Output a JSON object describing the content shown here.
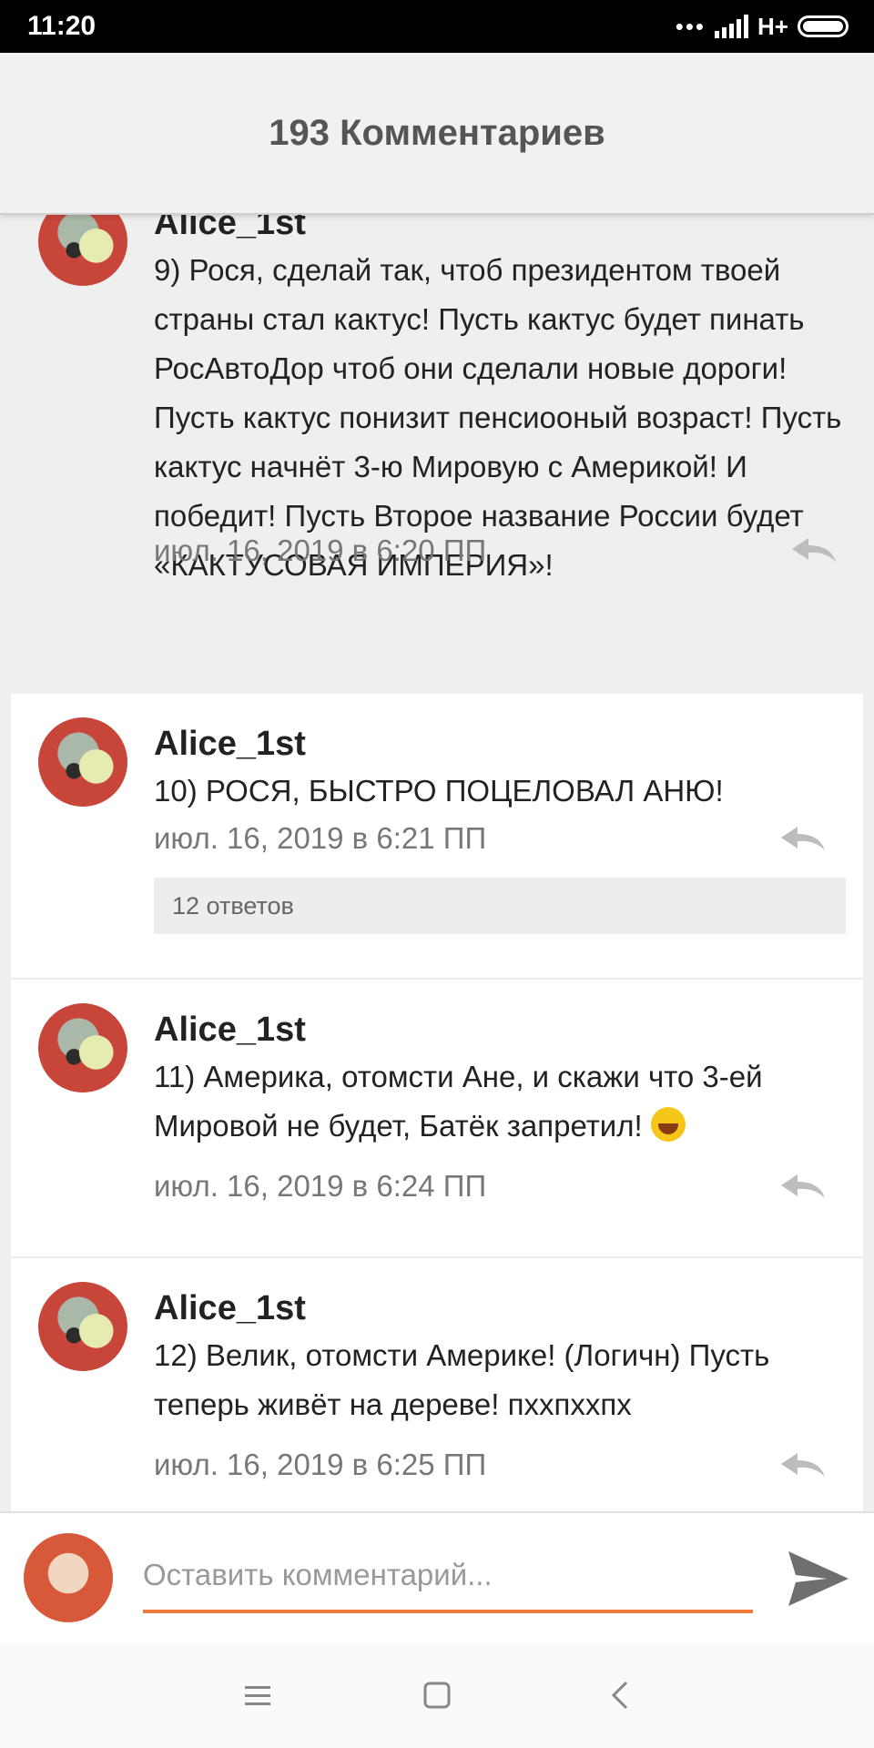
{
  "status_bar": {
    "time": "11:20",
    "network": "H+"
  },
  "header": {
    "title": "193 Комментариев"
  },
  "comments": [
    {
      "author": "Alice_1st",
      "text": "9) Рося, сделай так, чтоб президентом твоей страны стал кактус! Пусть кактус будет пинать РосАвтоДор чтоб они сделали новые дороги! Пусть кактус понизит пенсиооный возраст! Пусть кактус начнёт 3-ю Мировую с Америкой! И победит! Пусть Второе название России будет «КАКТУСОВАЯ ИМПЕРИЯ»!",
      "date": "июл. 16, 2019 в 6:20 ПП"
    },
    {
      "author": "Alice_1st",
      "text": "10) РОСЯ, БЫСТРО ПОЦЕЛОВАЛ АНЮ!",
      "date": "июл. 16, 2019 в 6:21 ПП",
      "replies_label": "12 ответов"
    },
    {
      "author": "Alice_1st",
      "text": "11) Америка, отомсти Ане, и скажи что 3-ей Мировой не будет, Батёк запретил!",
      "date": "июл. 16, 2019 в 6:24 ПП"
    },
    {
      "author": "Alice_1st",
      "text": "12) Велик, отомсти Америке! (Логичн) Пусть теперь живёт на дереве! пххпххпх",
      "date": "июл. 16, 2019 в 6:25 ПП"
    }
  ],
  "composer": {
    "placeholder": "Оставить комментарий..."
  },
  "icons": {
    "reply": "reply-arrow-icon",
    "send": "send-icon",
    "emoji": "laughing-tears-emoji",
    "nav": [
      "menu-icon",
      "home-square-icon",
      "back-chevron-icon"
    ]
  },
  "colors": {
    "accent": "#ef7a3a",
    "header_bg": "#f1f1f1",
    "meta_text": "#777777"
  }
}
